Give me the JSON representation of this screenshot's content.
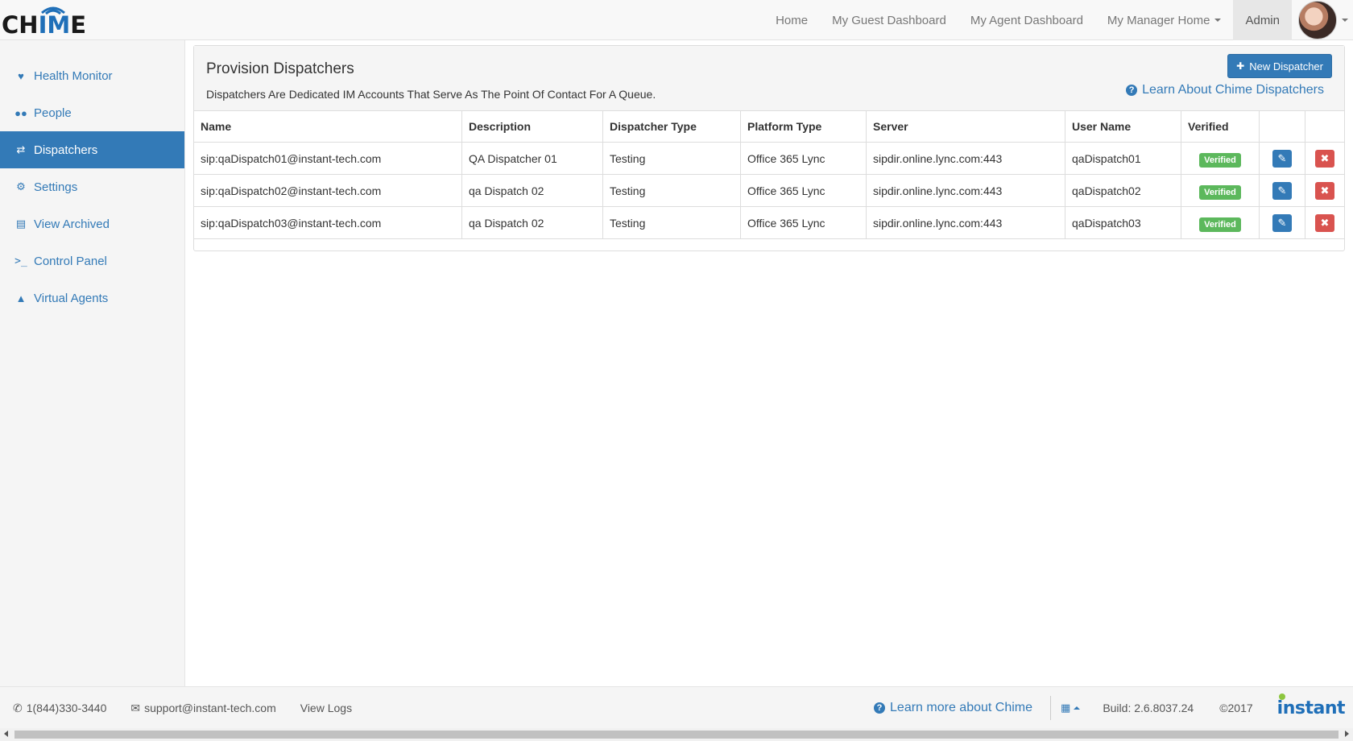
{
  "brand": {
    "logo_text_1": "CH",
    "logo_text_2": "IM",
    "logo_text_3": "E"
  },
  "nav": {
    "items": [
      "Home",
      "My Guest Dashboard",
      "My Agent Dashboard",
      "My Manager Home",
      "Admin"
    ],
    "active": "Admin"
  },
  "sidebar": {
    "items": [
      {
        "label": "Health Monitor",
        "icon": "heartbeat-icon"
      },
      {
        "label": "People",
        "icon": "users-icon"
      },
      {
        "label": "Dispatchers",
        "icon": "exchange-icon",
        "active": true
      },
      {
        "label": "Settings",
        "icon": "cogs-icon"
      },
      {
        "label": "View Archived",
        "icon": "archive-icon"
      },
      {
        "label": "Control Panel",
        "icon": "terminal-icon"
      },
      {
        "label": "Virtual Agents",
        "icon": "android-icon"
      }
    ]
  },
  "panel": {
    "title": "Provision Dispatchers",
    "subtitle": "Dispatchers Are Dedicated IM Accounts That Serve As The Point Of Contact For A Queue.",
    "new_button": "New Dispatcher",
    "learn_link": "Learn About Chime Dispatchers"
  },
  "table": {
    "headers": [
      "Name",
      "Description",
      "Dispatcher Type",
      "Platform Type",
      "Server",
      "User Name",
      "Verified",
      "",
      ""
    ],
    "rows": [
      {
        "name": "sip:qaDispatch01@instant-tech.com",
        "description": "QA Dispatcher 01",
        "type": "Testing",
        "platform": "Office 365 Lync",
        "server": "sipdir.online.lync.com:443",
        "user": "qaDispatch01",
        "verified": "Verified"
      },
      {
        "name": "sip:qaDispatch02@instant-tech.com",
        "description": "qa Dispatch 02",
        "type": "Testing",
        "platform": "Office 365 Lync",
        "server": "sipdir.online.lync.com:443",
        "user": "qaDispatch02",
        "verified": "Verified"
      },
      {
        "name": "sip:qaDispatch03@instant-tech.com",
        "description": "qa Dispatch 02",
        "type": "Testing",
        "platform": "Office 365 Lync",
        "server": "sipdir.online.lync.com:443",
        "user": "qaDispatch03",
        "verified": "Verified"
      }
    ]
  },
  "footer": {
    "phone": "1(844)330-3440",
    "email": "support@instant-tech.com",
    "view_logs": "View Logs",
    "learn_more": "Learn more about Chime",
    "build": "Build: 2.6.8037.24",
    "copyright": "©2017",
    "brand": "instant"
  },
  "colors": {
    "primary": "#337ab7",
    "success": "#5cb85c",
    "danger": "#d9534f"
  }
}
